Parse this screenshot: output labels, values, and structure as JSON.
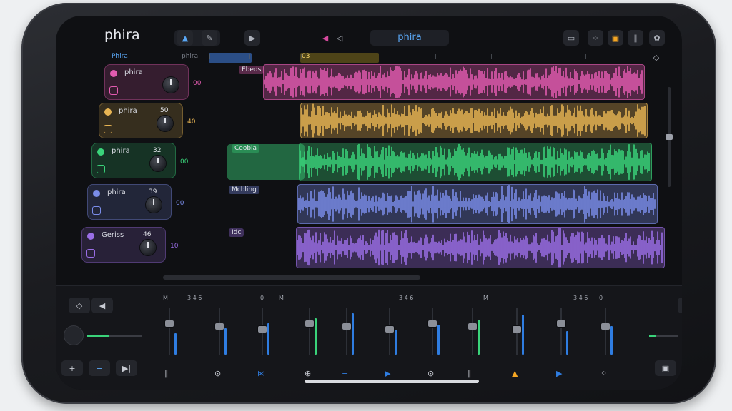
{
  "app": {
    "name": "phira",
    "transport_title": "phira"
  },
  "ruler": {
    "left_label": "Phira",
    "mid_label": "phira",
    "loop_label": "03"
  },
  "tracks": [
    {
      "name": "phira",
      "value": "",
      "num": "00",
      "color": "#e25bb0",
      "clip_label": "Ebeds"
    },
    {
      "name": "phira",
      "value": "50",
      "num": "40",
      "color": "#e8b554",
      "clip_label": ""
    },
    {
      "name": "phira",
      "value": "32",
      "num": "00",
      "color": "#3ad37a",
      "clip_label": "Ceobla"
    },
    {
      "name": "phira",
      "value": "39",
      "num": "00",
      "color": "#7a8ce8",
      "clip_label": "Mcbling"
    },
    {
      "name": "Geriss",
      "value": "46",
      "num": "10",
      "color": "#9a6ee6",
      "clip_label": "Idc"
    }
  ],
  "mixer": {
    "strip_labels": [
      "M",
      "3 4 6",
      "0",
      "M",
      "3 4 6",
      "M",
      "3 4 6",
      "0"
    ],
    "colors": {
      "accent": "#2f7de1",
      "green": "#3ad37a",
      "orange": "#f5a623",
      "purple": "#c04fd8"
    }
  }
}
